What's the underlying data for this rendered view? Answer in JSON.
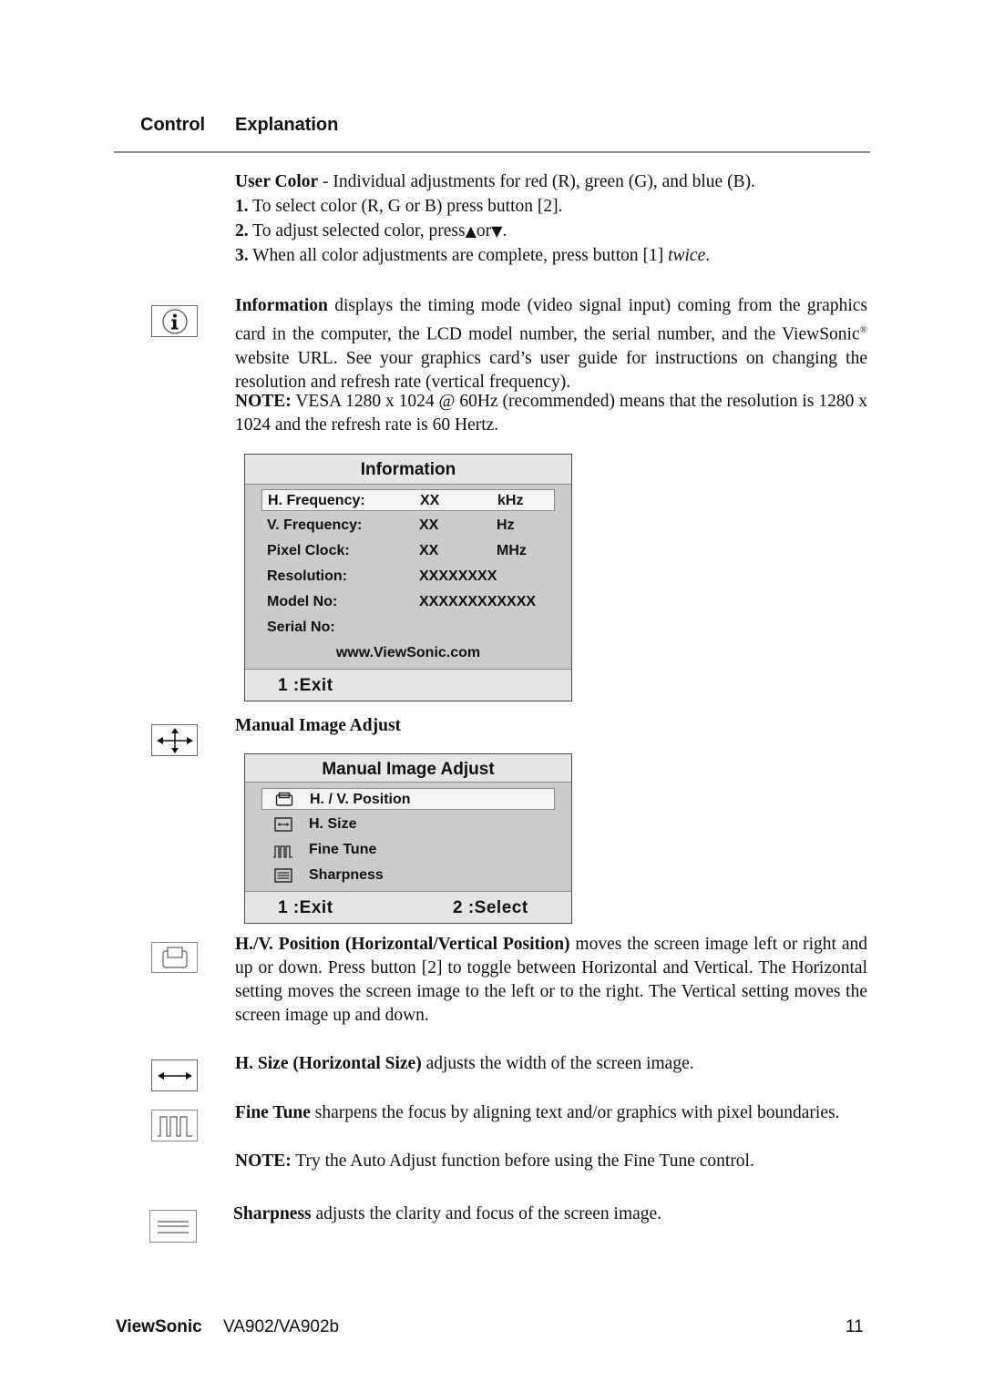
{
  "header": {
    "control_label": "Control",
    "explanation_label": "Explanation"
  },
  "user_color": {
    "title": "User Color",
    "intro": " - Individual adjustments for red (R), green (G),  and blue (B).",
    "steps": [
      {
        "num": "1.",
        "text": " To select color (R, G or B) press button [2]."
      },
      {
        "num": "2.",
        "text": " To adjust selected color, press",
        "up_glyph": "▲",
        "mid": "or",
        "down_glyph": "▼",
        "end": "."
      },
      {
        "num": "3.",
        "text": " When all color adjustments are complete, press button [1] ",
        "italic": "twice",
        "end": "."
      }
    ]
  },
  "information": {
    "icon": "info-icon",
    "title": "Information",
    "body1": " displays the timing mode (video signal input) coming from the graphics card in the computer, the LCD model number, the serial number, and the ViewSonic",
    "reg": "®",
    "body2": " website URL. See your graphics card’s user guide for instructions on changing the resolution and refresh rate (vertical frequency).",
    "note_label": "NOTE:",
    "note_text": " VESA 1280 x 1024 @ 60Hz (recommended) means that the resolution is 1280 x 1024 and the refresh rate is 60 Hertz."
  },
  "info_osd": {
    "title": "Information",
    "rows": [
      {
        "label": "H. Frequency:",
        "value": "XX",
        "unit": "kHz",
        "selected": true
      },
      {
        "label": "V. Frequency:",
        "value": "XX",
        "unit": "Hz"
      },
      {
        "label": "Pixel Clock:",
        "value": "XX",
        "unit": "MHz"
      },
      {
        "label": "Resolution:",
        "value": "XXXXXXXX",
        "unit": ""
      },
      {
        "label": "Model No:",
        "value": "XXXXXXXXXXXX",
        "unit": ""
      },
      {
        "label": "Serial No:",
        "value": "",
        "unit": ""
      }
    ],
    "website": "www.ViewSonic.com",
    "exit": "1 :Exit"
  },
  "manual_image_adjust": {
    "icon": "four-way-arrows-icon",
    "heading": "Manual Image Adjust"
  },
  "mia_osd": {
    "title": "Manual Image Adjust",
    "items": [
      {
        "icon": "position-icon",
        "label": "H. / V. Position",
        "selected": true
      },
      {
        "icon": "h-size-icon",
        "label": "H. Size"
      },
      {
        "icon": "fine-tune-icon",
        "label": "Fine Tune"
      },
      {
        "icon": "sharpness-icon",
        "label": "Sharpness"
      }
    ],
    "exit": "1 :Exit",
    "select": "2 :Select"
  },
  "hv_position": {
    "icon": "position-icon",
    "title": "H./V. Position (Horizontal/Vertical Position)",
    "body": " moves the screen image left or right and up or down. Press button [2] to toggle between Horizontal and Vertical. The Horizontal setting moves the screen image to the left or to the right. The Vertical setting moves the screen image up and down."
  },
  "h_size": {
    "icon": "h-size-icon",
    "title": "H. Size (Horizontal Size)",
    "body": " adjusts the width of the screen image."
  },
  "fine_tune": {
    "icon": "fine-tune-icon",
    "title": "Fine Tune",
    "body": " sharpens the focus by aligning text and/or graphics with pixel boundaries.",
    "note_label": "NOTE:",
    "note_text": " Try the Auto Adjust function before using the Fine Tune control."
  },
  "sharpness": {
    "icon": "sharpness-icon",
    "title": "Sharpness",
    "body": " adjusts the clarity and focus of the screen image."
  },
  "footer": {
    "brand": "ViewSonic",
    "model": "VA902/VA902b",
    "page": "11"
  }
}
